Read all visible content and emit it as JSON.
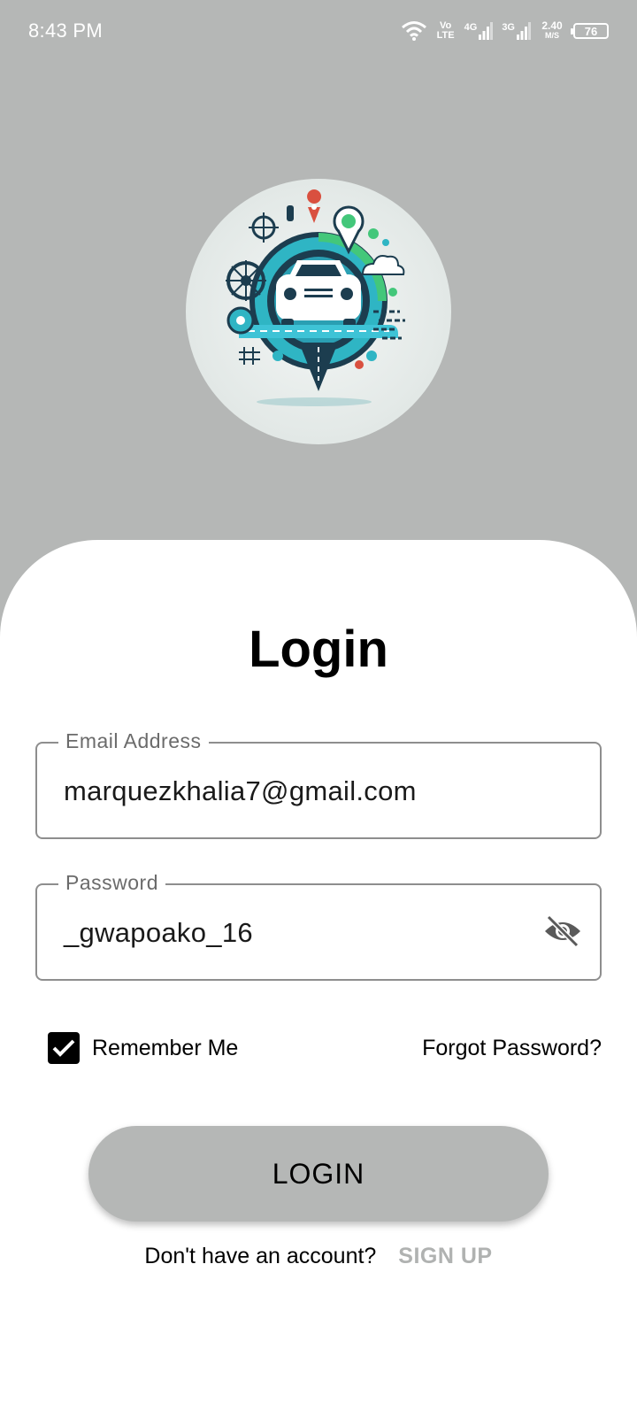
{
  "status_bar": {
    "time": "8:43 PM",
    "volte": "Vo LTE",
    "net1": "4G",
    "net2": "3G",
    "speed_value": "2.40",
    "speed_unit": "M/S",
    "battery": "76"
  },
  "logo": {
    "icon": "car-location-logo"
  },
  "login": {
    "title": "Login",
    "email": {
      "label": "Email Address",
      "value": "marquezkhalia7@gmail.com"
    },
    "password": {
      "label": "Password",
      "value": "_gwapoako_16",
      "visibility_icon": "eye-off-icon"
    },
    "remember_me": {
      "label": "Remember Me",
      "checked": true
    },
    "forgot_password": "Forgot Password?",
    "login_button": "LOGIN",
    "no_account_text": "Don't have an account?",
    "signup_link": "SIGN UP"
  },
  "colors": {
    "header_bg": "#b5b7b6",
    "card_bg": "#ffffff",
    "button_bg": "#b5b7b6",
    "signup_link": "#b0b2b1",
    "logo_teal": "#2fb5c4",
    "logo_green": "#43c77a",
    "logo_dark": "#1c3d4f"
  }
}
